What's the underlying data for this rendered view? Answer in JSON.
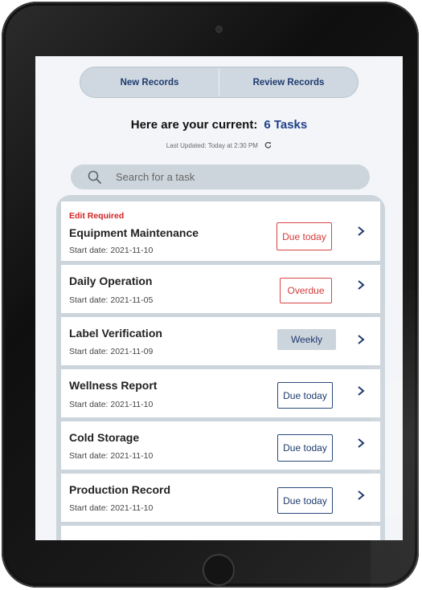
{
  "nav": {
    "new_records": "New Records",
    "review_records": "Review Records"
  },
  "summary": {
    "headline": "Here are your current:",
    "count": "6 Tasks",
    "last_updated": "Last Updated: Today at 2:30 PM",
    "refresh_icon": "refresh-icon"
  },
  "search": {
    "placeholder": "Search for a task",
    "icon": "search-icon"
  },
  "tasks": [
    {
      "flag": "Edit Required",
      "title": "Equipment Maintenance",
      "date": "Start date: 2021-11-10",
      "status": "Due today",
      "status_color": "#d94444"
    },
    {
      "title": "Daily Operation",
      "date": "Start date: 2021-11-05",
      "status": "Overdue",
      "status_color": "#d94444"
    },
    {
      "title": "Label Verification",
      "date": "Start date: 2021-11-09",
      "status": "Weekly",
      "status_color": "#cdd5dc"
    },
    {
      "title": "Wellness Report",
      "date": "Start date: 2021-11-10",
      "status": "Due today",
      "status_color": "#2a4a7c"
    },
    {
      "title": "Cold Storage",
      "date": "Start date: 2021-11-10",
      "status": "Due today",
      "status_color": "#2a4a7c"
    },
    {
      "title": "Production Record",
      "date": "Start date: 2021-11-10",
      "status": "Due today",
      "status_color": "#2a4a7c"
    }
  ],
  "colors": {
    "accent": "#1f3f8a",
    "alert": "#d42222",
    "panel": "#cdd5dc"
  }
}
